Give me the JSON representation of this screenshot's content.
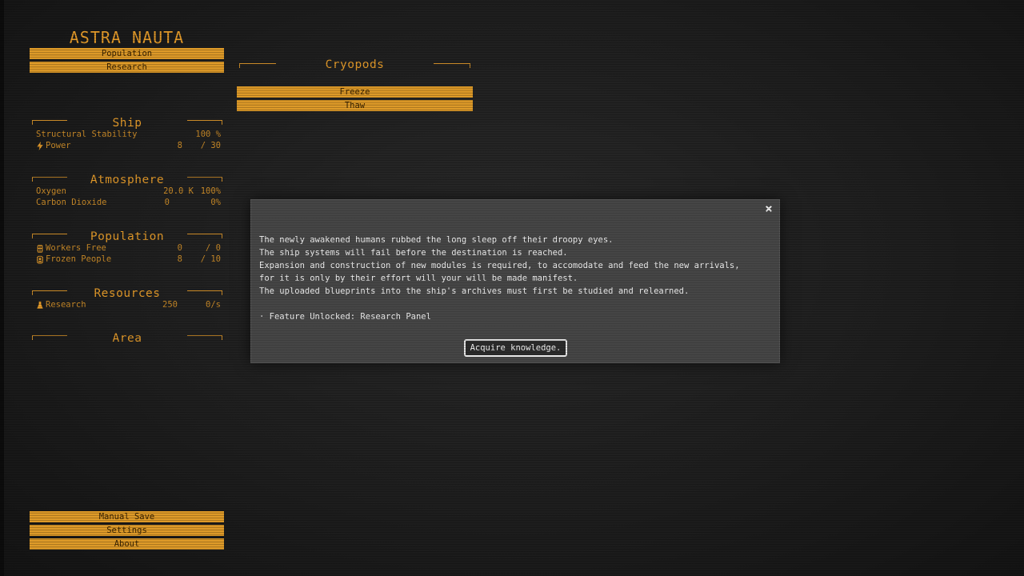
{
  "game": {
    "title": "ASTRA NAUTA"
  },
  "top_menu": {
    "population": "Population",
    "research": "Research"
  },
  "ship": {
    "title": "Ship",
    "structural_stability": {
      "label": "Structural Stability",
      "value": "100 %"
    },
    "power": {
      "label": "Power",
      "value": "8",
      "max": "/ 30"
    }
  },
  "atmosphere": {
    "title": "Atmosphere",
    "oxygen": {
      "label": "Oxygen",
      "amount": "20.0 K",
      "percent": "100%"
    },
    "carbon_dioxide": {
      "label": "Carbon Dioxide",
      "amount": "0",
      "percent": "0%"
    }
  },
  "population": {
    "title": "Population",
    "workers_free": {
      "label": "Workers Free",
      "value": "0",
      "max": "/ 0"
    },
    "frozen_people": {
      "label": "Frozen People",
      "value": "8",
      "max": "/ 10"
    }
  },
  "resources": {
    "title": "Resources",
    "research": {
      "label": "Research",
      "value": "250",
      "rate": "0/s"
    }
  },
  "area": {
    "title": "Area"
  },
  "bottom_menu": {
    "manual_save": "Manual Save",
    "settings": "Settings",
    "about": "About"
  },
  "cryopods": {
    "title": "Cryopods",
    "freeze": "Freeze",
    "thaw": "Thaw"
  },
  "dialog": {
    "close": "×",
    "lines": [
      "The newly awakened humans rubbed the long sleep off their droopy eyes.",
      "The ship systems will fail before the destination is reached.",
      "Expansion and construction of new modules is required, to accomodate and feed the new arrivals,",
      "for it is only by their effort will your will be made manifest.",
      "The uploaded blueprints into the ship's archives must first be studied and relearned."
    ],
    "feature": "· Feature Unlocked: Research Panel",
    "button": "Acquire knowledge."
  },
  "colors": {
    "accent": "#e8a12a",
    "text_orange": "#e39a2a",
    "background": "#1d1d1d",
    "dialog_bg": "#454545"
  },
  "icons": {
    "power": "lightning-bolt-icon",
    "workers": "worker-icon",
    "frozen": "frozen-person-icon",
    "research": "flask-icon"
  }
}
